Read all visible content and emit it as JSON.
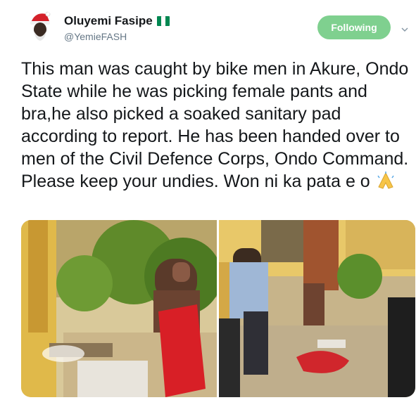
{
  "user": {
    "display_name": "Oluyemi Fasipe",
    "handle": "@YemieFASH",
    "avatar_icon": "santa-hat-portrait-icon",
    "flag_icon": "nigeria-flag-icon",
    "flag_colors": [
      "#008751",
      "#ffffff",
      "#008751"
    ]
  },
  "follow_button": {
    "label": "Following",
    "color": "#7fd08f"
  },
  "menu_icon": "chevron-down-icon",
  "tweet": {
    "text": "This man was caught by bike men in Akure, Ondo State while he was picking female pants and bra,he also picked a soaked sanitary pad according to report. He has been handed over to men of the Civil Defence Corps, Ondo Command. Please keep your undies. Won ni ka pata e o",
    "emoji": "folded-hands-emoji"
  },
  "media": {
    "photos": [
      {
        "name": "photo-man-with-red-clothes"
      },
      {
        "name": "photo-courtyard-scene"
      }
    ]
  }
}
